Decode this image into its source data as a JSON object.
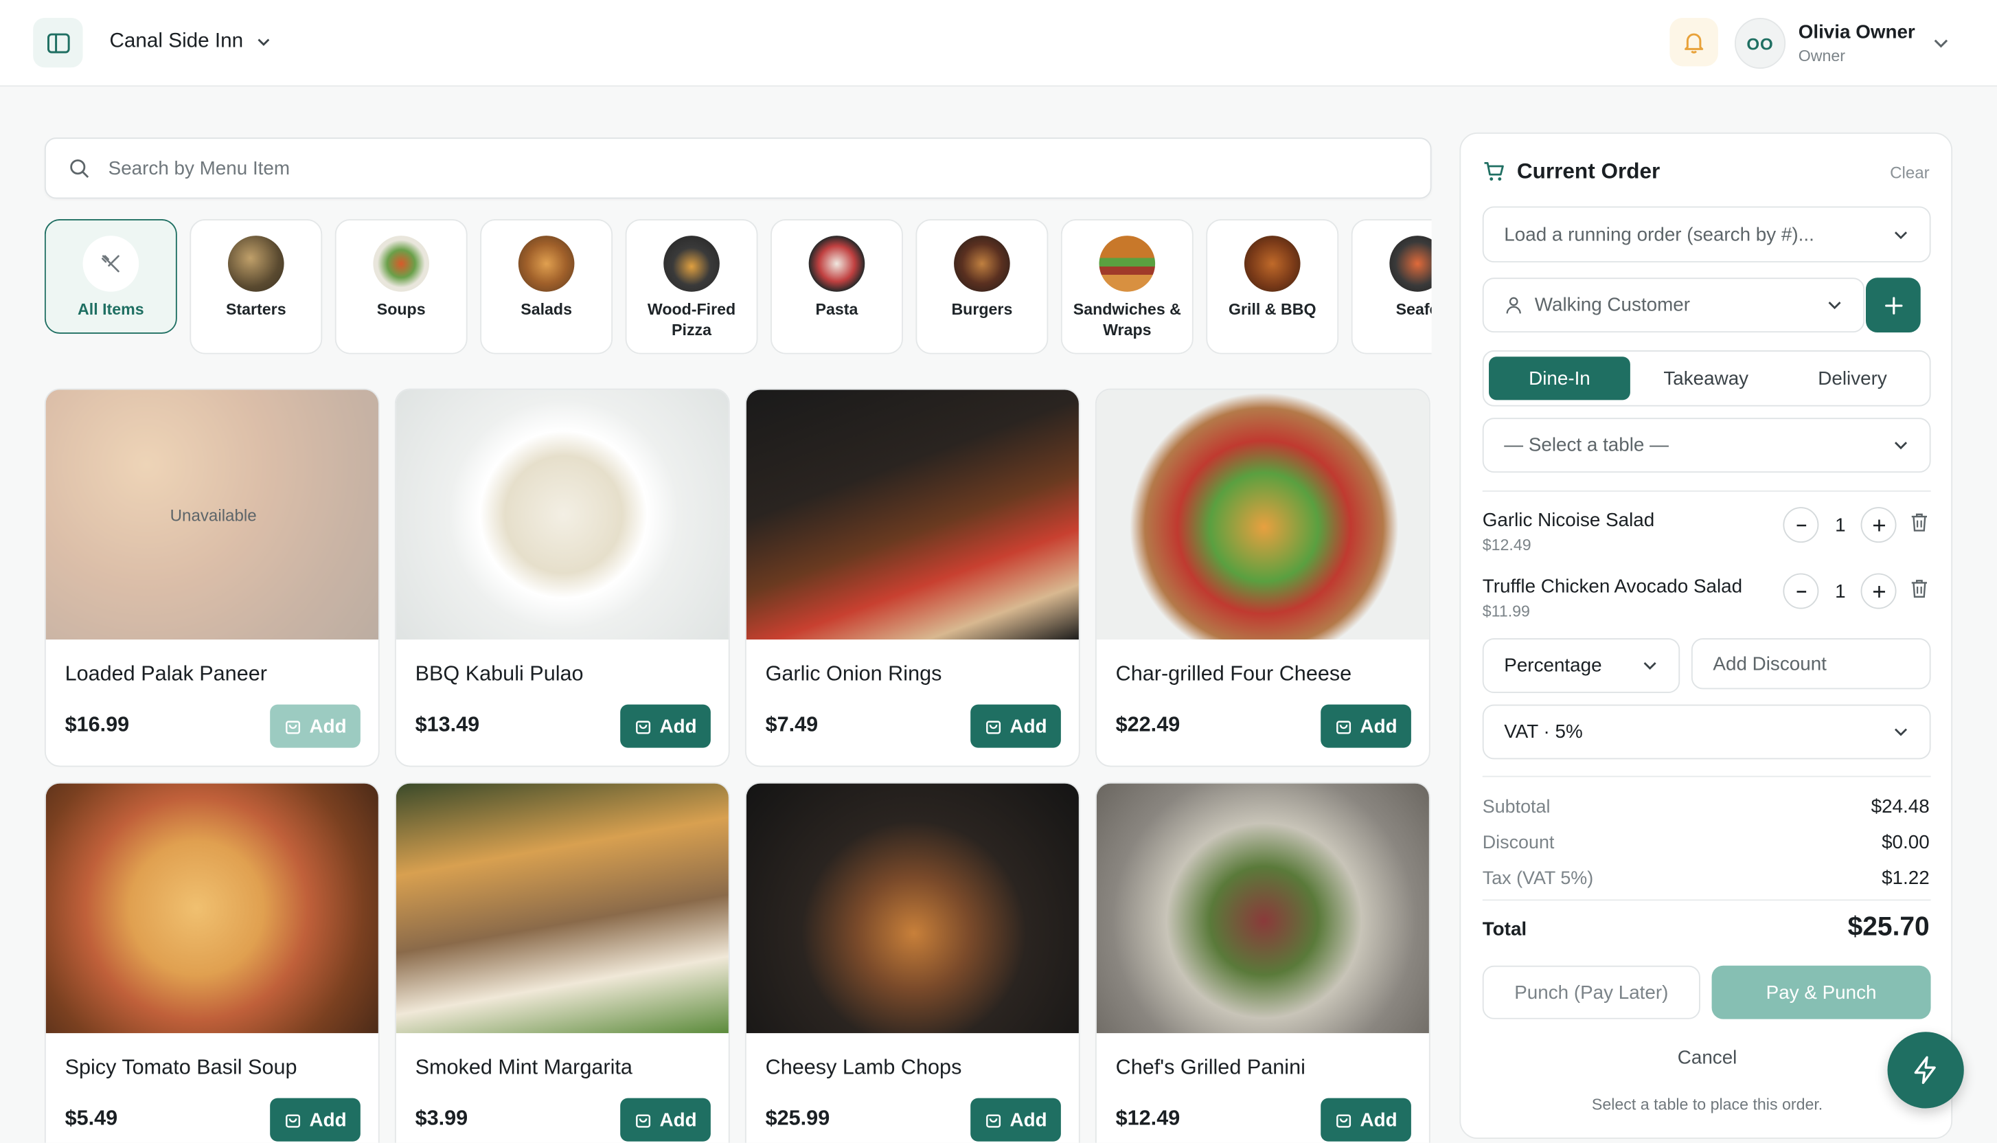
{
  "header": {
    "restaurant": "Canal Side Inn",
    "user_initials": "OO",
    "user_name": "Olivia Owner",
    "user_role": "Owner"
  },
  "search": {
    "placeholder": "Search by Menu Item"
  },
  "categories": [
    {
      "label": "All Items",
      "active": true
    },
    {
      "label": "Starters"
    },
    {
      "label": "Soups"
    },
    {
      "label": "Salads"
    },
    {
      "label": "Wood-Fired Pizza"
    },
    {
      "label": "Pasta"
    },
    {
      "label": "Burgers"
    },
    {
      "label": "Sandwiches & Wraps"
    },
    {
      "label": "Grill & BBQ"
    },
    {
      "label": "Seafo"
    }
  ],
  "products": [
    {
      "name": "Loaded Palak Paneer",
      "price": "$16.99",
      "add": "Add",
      "status": "Unavailable"
    },
    {
      "name": "BBQ Kabuli Pulao",
      "price": "$13.49",
      "add": "Add"
    },
    {
      "name": "Garlic Onion Rings",
      "price": "$7.49",
      "add": "Add"
    },
    {
      "name": "Char-grilled Four Cheese",
      "price": "$22.49",
      "add": "Add"
    },
    {
      "name": "Spicy Tomato Basil Soup",
      "price": "$5.49",
      "add": "Add"
    },
    {
      "name": "Smoked Mint Margarita",
      "price": "$3.99",
      "add": "Add"
    },
    {
      "name": "Cheesy Lamb Chops",
      "price": "$25.99",
      "add": "Add"
    },
    {
      "name": "Chef's Grilled Panini",
      "price": "$12.49",
      "add": "Add"
    }
  ],
  "order": {
    "title": "Current Order",
    "clear": "Clear",
    "load_placeholder": "Load a running order (search by #)...",
    "customer": "Walking Customer",
    "modes": [
      "Dine-In",
      "Takeaway",
      "Delivery"
    ],
    "table_placeholder": "— Select a table —",
    "items": [
      {
        "name": "Garlic Nicoise Salad",
        "price": "$12.49",
        "qty": "1"
      },
      {
        "name": "Truffle Chicken Avocado Salad",
        "price": "$11.99",
        "qty": "1"
      }
    ],
    "discount_type": "Percentage",
    "discount_placeholder": "Add Discount",
    "tax": "VAT · 5%",
    "subtotal_label": "Subtotal",
    "subtotal": "$24.48",
    "discount_label": "Discount",
    "discount": "$0.00",
    "tax_label": "Tax (VAT 5%)",
    "tax_value": "$1.22",
    "total_label": "Total",
    "total": "$25.70",
    "punch_later": "Punch (Pay Later)",
    "pay_punch": "Pay & Punch",
    "cancel": "Cancel",
    "hint": "Select a table to place this order."
  },
  "colors": {
    "accent": "#1f6f62",
    "accent_light": "#86bfb3",
    "bell_bg": "#fdf6e7"
  }
}
